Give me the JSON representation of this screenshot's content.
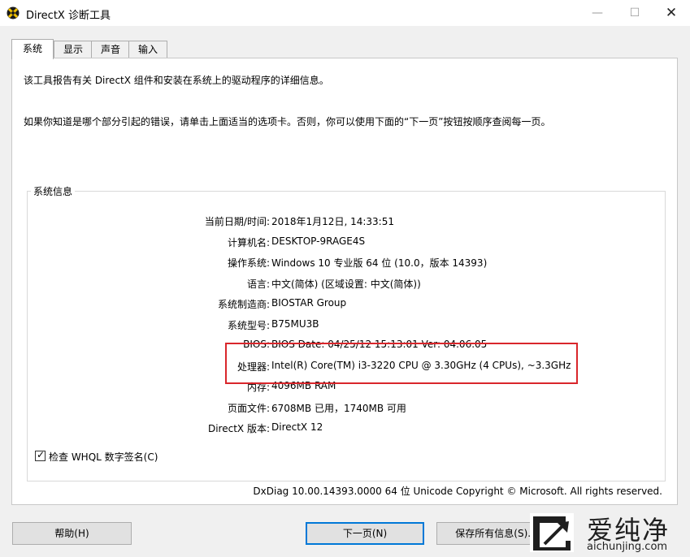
{
  "window": {
    "title": "DirectX 诊断工具"
  },
  "tabs": [
    {
      "label": "系统"
    },
    {
      "label": "显示"
    },
    {
      "label": "声音"
    },
    {
      "label": "输入"
    }
  ],
  "intro": {
    "line1": "该工具报告有关 DirectX 组件和安装在系统上的驱动程序的详细信息。",
    "line2": "如果你知道是哪个部分引起的错误，请单击上面适当的选项卡。否则，你可以使用下面的“下一页”按钮按顺序查阅每一页。"
  },
  "system_info": {
    "group_label": "系统信息",
    "rows": [
      {
        "label": "当前日期/时间:",
        "value": "2018年1月12日, 14:33:51"
      },
      {
        "label": "计算机名:",
        "value": "DESKTOP-9RAGE4S"
      },
      {
        "label": "操作系统:",
        "value": "Windows 10 专业版 64 位 (10.0，版本 14393)"
      },
      {
        "label": "语言:",
        "value": "中文(简体) (区域设置: 中文(简体))"
      },
      {
        "label": "系统制造商:",
        "value": "BIOSTAR Group"
      },
      {
        "label": "系统型号:",
        "value": "B75MU3B"
      },
      {
        "label": "BIOS:",
        "value": "BIOS Date: 04/25/12 15:13:01 Ver: 04.06.05"
      },
      {
        "label": "处理器:",
        "value": "Intel(R) Core(TM) i3-3220 CPU @ 3.30GHz (4 CPUs), ~3.3GHz"
      },
      {
        "label": "内存:",
        "value": "4096MB RAM"
      },
      {
        "label": "页面文件:",
        "value": "6708MB 已用，1740MB 可用"
      },
      {
        "label": "DirectX 版本:",
        "value": "DirectX 12"
      }
    ]
  },
  "whql": {
    "label": "检查 WHQL 数字签名(C)",
    "checked": true
  },
  "footer": {
    "text": "DxDiag 10.00.14393.0000 64 位 Unicode  Copyright © Microsoft. All rights reserved."
  },
  "buttons": {
    "help": "帮助(H)",
    "next": "下一页(N)",
    "save": "保存所有信息(S)..."
  },
  "watermark": {
    "text": "爱纯净",
    "url": "aichunjing.com"
  },
  "colors": {
    "highlight": "#d9262b",
    "focus": "#0078d7"
  }
}
